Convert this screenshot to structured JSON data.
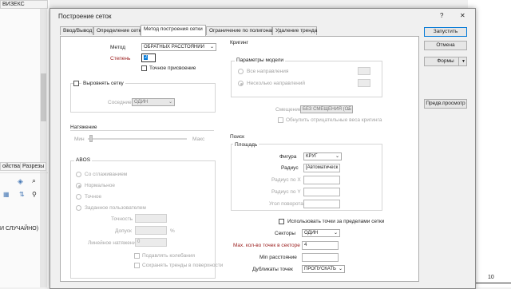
{
  "background": {
    "left_top_tab": "ВИЗЕКС",
    "properties_tab": "ойства",
    "sections_tab": "Разрезы",
    "random_text": "И СЛУЧАЙНО)",
    "ruler_value": "10"
  },
  "dialog": {
    "title": "Построение сеток",
    "help": "?",
    "close": "✕",
    "tabs": [
      "Ввод/Вывод",
      "Определение сетки",
      "Метод построения сетки",
      "Ограничение по полигонам",
      "Удаление тренда"
    ],
    "buttons": {
      "run": "Запустить",
      "cancel": "Отмена",
      "forms": "Формы",
      "preview": "Предв.просмотр"
    }
  },
  "method": {
    "method_label": "Метод",
    "method_value": "ОБРАТНЫХ РАССТОЯНИЙ",
    "power_label": "Степень",
    "power_value": "2",
    "exact_label": "Точное присвоение",
    "smooth_label": "Выровнять сетку",
    "neighbors_label": "Соседние",
    "neighbors_value": "ОДИН"
  },
  "tension": {
    "title": "Натяжение",
    "min": "Мин",
    "max": "Макс"
  },
  "abos": {
    "title": "ABOS",
    "options": [
      "Со сглаживанием",
      "Нормальное",
      "Точное",
      "Заданное пользователем"
    ],
    "selected": "Нормальное",
    "accuracy_label": "Точность",
    "tolerance_label": "Допуск",
    "percent": "%",
    "linear_label": "Линейное натяжение",
    "linear_value": "0",
    "dampen_label": "Подавлять колебания",
    "keep_trends_label": "Сохранять тренды в поверхности"
  },
  "kriging": {
    "title": "Кригинг",
    "model_title": "Параметры модели",
    "all_dirs": "Все направления",
    "multi_dirs": "Несколько направлений",
    "offset_label": "Смещение",
    "offset_value": "БЕЗ СМЕЩЕНИЯ (ОБ",
    "zero_neg_label": "Обнулить отрицательные веса кригинга"
  },
  "search": {
    "title": "Поиск",
    "area_title": "Площадь",
    "shape_label": "Фигура",
    "shape_value": "КРУГ",
    "radius_label": "Радиус",
    "radius_value": "[Автоматическ",
    "radius_x_label": "Радиус по X",
    "radius_y_label": "Радиус по Y",
    "angle_label": "Угол поворота",
    "use_outside_label": "Использовать точки за пределами сетки",
    "sectors_label": "Секторы",
    "sectors_value": "ОДИН",
    "max_points_label": "Max. кол-во точек в секторе",
    "max_points_value": "4",
    "min_dist_label": "Min расстояние",
    "dup_label": "Дубликаты точек",
    "dup_value": "ПРОПУСКАТЬ"
  }
}
